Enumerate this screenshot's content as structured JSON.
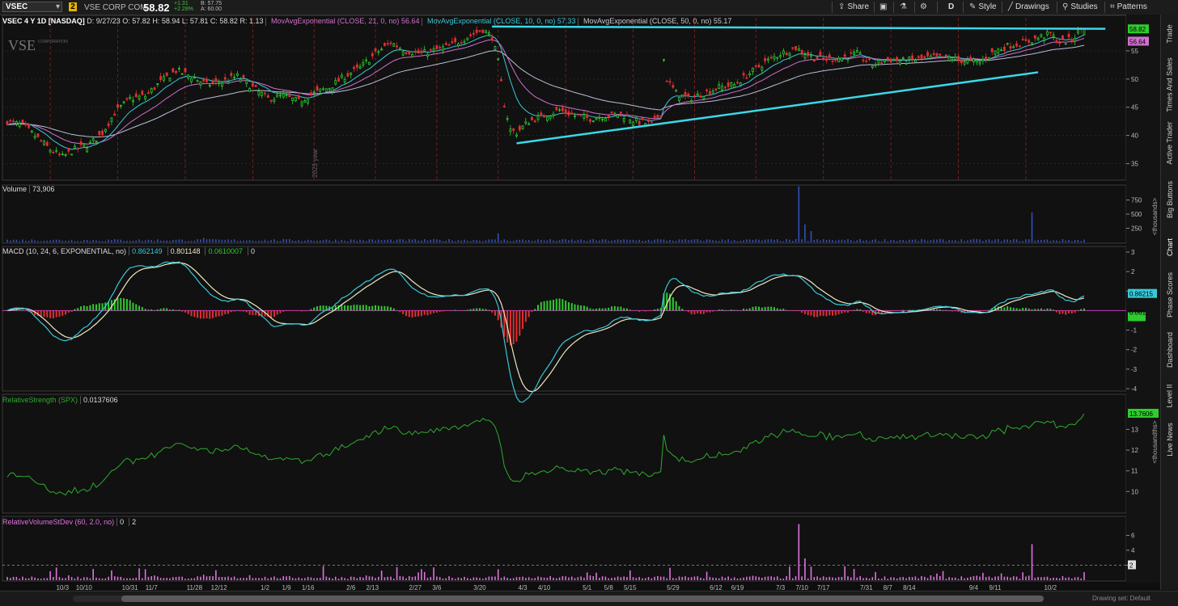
{
  "toolbar": {
    "symbol": "VSEC",
    "link_badge": "2",
    "company": "VSE CORP COM",
    "last": "58.82",
    "change": "+1.31",
    "change_pct": "+2.28%",
    "bid": "B: 57.75",
    "ask": "A: 60.00",
    "share": "Share",
    "period": "D",
    "style": "Style",
    "drawings": "Drawings",
    "studies": "Studies",
    "patterns": "Patterns"
  },
  "header": {
    "title": "VSEC 4 Y 1D [NASDAQ]",
    "date": "D: 9/27/23",
    "open": "O: 57.82",
    "high": "H: 58.94",
    "low": "L: 57.81",
    "close": "C: 58.82",
    "range": "R: 1.13",
    "ma21_label": "MovAvgExponential (CLOSE, 21, 0, no)",
    "ma21_value": "56.64",
    "ma10_label": "MovAvgExponential (CLOSE, 10, 0, no)",
    "ma10_value": "57.33",
    "ma50_label": "MovAvgExponential (CLOSE, 50, 0, no)",
    "ma50_value": "55.17"
  },
  "panels": {
    "volume_label": "Volume",
    "volume_value": "73,906",
    "macd_label": "MACD (10, 24, 6, EXPONENTIAL, no)",
    "macd_v1": "0.862149",
    "macd_v2": "0.801148",
    "macd_v3": "0.0610007",
    "macd_v4": "0",
    "rs_label": "RelativeStrength (SPX)",
    "rs_value": "0.0137606",
    "rv_label": "RelativeVolumeStDev (60, 2.0, no)",
    "rv_v1": "0",
    "rv_v2": "2",
    "thousands": "<thousands>",
    "thousandths": "<thousandths>",
    "logo": "VSE",
    "logo_sub": "CORPORATION",
    "year_marker": "2023 year"
  },
  "sidebar_tabs": [
    "Trade",
    "Times And Sales",
    "Active Trader",
    "Big Buttons",
    "Chart",
    "Phase Scores",
    "Dashboard",
    "Level II",
    "Live News"
  ],
  "bottom": {
    "zoom_text": "Drawing set: Default"
  },
  "colors": {
    "up": "#2ecc2e",
    "down": "#e03030",
    "ma10": "#39c8d8",
    "ma21": "#d070d0",
    "ma50": "#b8c0d8",
    "trend": "#3ad8e8",
    "rs": "#2eaa2e",
    "rv": "#e070e0"
  },
  "chart_data": {
    "type": "candlestick",
    "price_axis": {
      "ticks": [
        35,
        40,
        45,
        50,
        55
      ],
      "range": [
        32.5,
        60
      ],
      "markers": {
        "last": "58.82",
        "ma21": "56.64"
      }
    },
    "x_axis_labels": [
      "10/3",
      "10/10",
      "10/31",
      "11/7",
      "11/28",
      "12/12",
      "1/2",
      "1/9",
      "1/16",
      "2/6",
      "2/13",
      "2/27",
      "3/6",
      "3/20",
      "4/3",
      "4/10",
      "5/1",
      "5/8",
      "5/15",
      "5/29",
      "6/12",
      "6/19",
      "7/3",
      "7/10",
      "7/17",
      "7/31",
      "8/7",
      "8/14",
      "9/4",
      "9/11",
      "10/2"
    ],
    "price_path": [
      [
        0,
        42.5
      ],
      [
        5,
        41.8
      ],
      [
        10,
        39.5
      ],
      [
        14,
        37.5
      ],
      [
        18,
        36.2
      ],
      [
        22,
        37.5
      ],
      [
        27,
        38.5
      ],
      [
        31,
        40.5
      ],
      [
        35,
        44
      ],
      [
        40,
        46.5
      ],
      [
        45,
        47
      ],
      [
        50,
        49.5
      ],
      [
        55,
        51.5
      ],
      [
        60,
        50.5
      ],
      [
        65,
        49
      ],
      [
        70,
        49.5
      ],
      [
        75,
        50.5
      ],
      [
        80,
        48.5
      ],
      [
        85,
        46.5
      ],
      [
        90,
        47
      ],
      [
        95,
        46
      ],
      [
        100,
        47.5
      ],
      [
        105,
        48.5
      ],
      [
        110,
        50.5
      ],
      [
        115,
        52
      ],
      [
        120,
        54.5
      ],
      [
        125,
        56.5
      ],
      [
        130,
        55
      ],
      [
        135,
        54.5
      ],
      [
        140,
        55.2
      ],
      [
        145,
        56
      ],
      [
        150,
        57.5
      ],
      [
        155,
        58.8
      ],
      [
        158,
        57.5
      ],
      [
        160,
        53
      ],
      [
        162,
        45.5
      ],
      [
        164,
        41
      ],
      [
        166,
        40.5
      ],
      [
        170,
        42.5
      ],
      [
        175,
        43.5
      ],
      [
        180,
        44.5
      ],
      [
        185,
        43.5
      ],
      [
        190,
        43
      ],
      [
        195,
        43.5
      ],
      [
        200,
        43.8
      ],
      [
        205,
        42.5
      ],
      [
        210,
        42
      ],
      [
        213,
        44
      ],
      [
        214,
        53.5
      ],
      [
        215,
        50
      ],
      [
        218,
        47.5
      ],
      [
        222,
        46.5
      ],
      [
        227,
        47.5
      ],
      [
        232,
        48.5
      ],
      [
        237,
        49
      ],
      [
        242,
        51
      ],
      [
        247,
        53
      ],
      [
        252,
        54.5
      ],
      [
        257,
        55.5
      ],
      [
        262,
        54
      ],
      [
        267,
        53.5
      ],
      [
        272,
        53.8
      ],
      [
        277,
        54.5
      ],
      [
        282,
        52.5
      ],
      [
        287,
        53.5
      ],
      [
        292,
        53.2
      ],
      [
        297,
        53.5
      ],
      [
        302,
        53.8
      ],
      [
        307,
        53.8
      ],
      [
        312,
        53.2
      ],
      [
        317,
        53
      ],
      [
        322,
        55
      ],
      [
        327,
        56
      ],
      [
        332,
        56.5
      ],
      [
        337,
        57.5
      ],
      [
        340,
        58
      ],
      [
        343,
        56.5
      ],
      [
        347,
        57
      ],
      [
        350,
        58.82
      ]
    ],
    "volume_spikes": [
      [
        258,
        650
      ],
      [
        334,
        230
      ],
      [
        160,
        160
      ],
      [
        64,
        80
      ],
      [
        212,
        60
      ]
    ],
    "rs_range": [
      9,
      14.5
    ],
    "rs_last": "13.7606",
    "macd_last": "0.86215",
    "macd_hist_last": "0.061",
    "macd_range": [
      -4,
      3
    ],
    "rv_last": "2"
  }
}
